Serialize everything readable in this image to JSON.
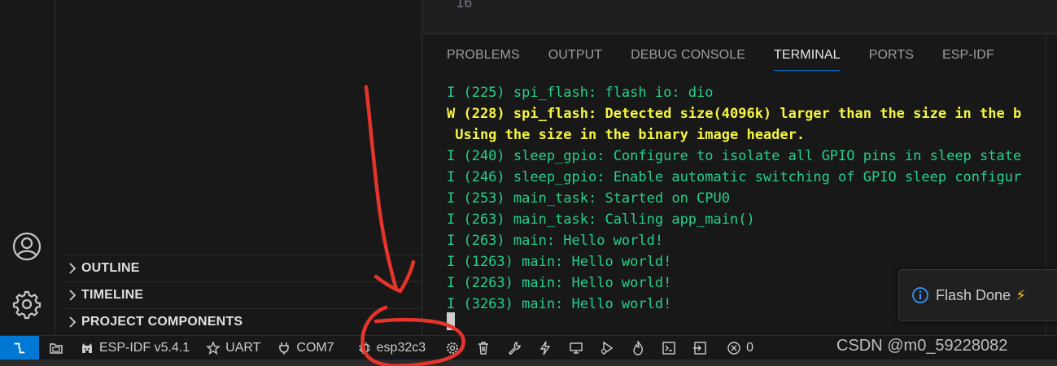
{
  "editor": {
    "line_number": "16"
  },
  "sidebar": {
    "sections": [
      {
        "title": "OUTLINE"
      },
      {
        "title": "TIMELINE"
      },
      {
        "title": "PROJECT COMPONENTS"
      }
    ]
  },
  "panel": {
    "tabs": [
      {
        "label": "PROBLEMS",
        "active": false
      },
      {
        "label": "OUTPUT",
        "active": false
      },
      {
        "label": "DEBUG CONSOLE",
        "active": false
      },
      {
        "label": "TERMINAL",
        "active": true
      },
      {
        "label": "PORTS",
        "active": false
      },
      {
        "label": "ESP-IDF",
        "active": false
      }
    ],
    "terminal_lines": [
      {
        "text": "I (225) spi_flash: flash io: dio",
        "level": "info"
      },
      {
        "text": "W (228) spi_flash: Detected size(4096k) larger than the size in the b",
        "level": "warn"
      },
      {
        "text": " Using the size in the binary image header.",
        "level": "warn"
      },
      {
        "text": "I (240) sleep_gpio: Configure to isolate all GPIO pins in sleep state",
        "level": "info"
      },
      {
        "text": "I (246) sleep_gpio: Enable automatic switching of GPIO sleep configur",
        "level": "info"
      },
      {
        "text": "I (253) main_task: Started on CPU0",
        "level": "info"
      },
      {
        "text": "I (263) main_task: Calling app_main()",
        "level": "info"
      },
      {
        "text": "I (263) main: Hello world!",
        "level": "info"
      },
      {
        "text": "I (1263) main: Hello world!",
        "level": "info"
      },
      {
        "text": "I (2263) main: Hello world!",
        "level": "info"
      },
      {
        "text": "I (3263) main: Hello world!",
        "level": "info"
      }
    ]
  },
  "toast": {
    "message": "Flash Done",
    "emoji": "⚡"
  },
  "status_bar": {
    "idf_version": "ESP-IDF v5.4.1",
    "flash_method": "UART",
    "port": "COM7",
    "target": "esp32c3",
    "problems_count": "0",
    "watermark": "CSDN @m0_59228082"
  },
  "colors": {
    "accent": "#0078d4",
    "info_text": "#23d18b",
    "warn_text": "#f5f543",
    "annotation": "#e5342b"
  }
}
